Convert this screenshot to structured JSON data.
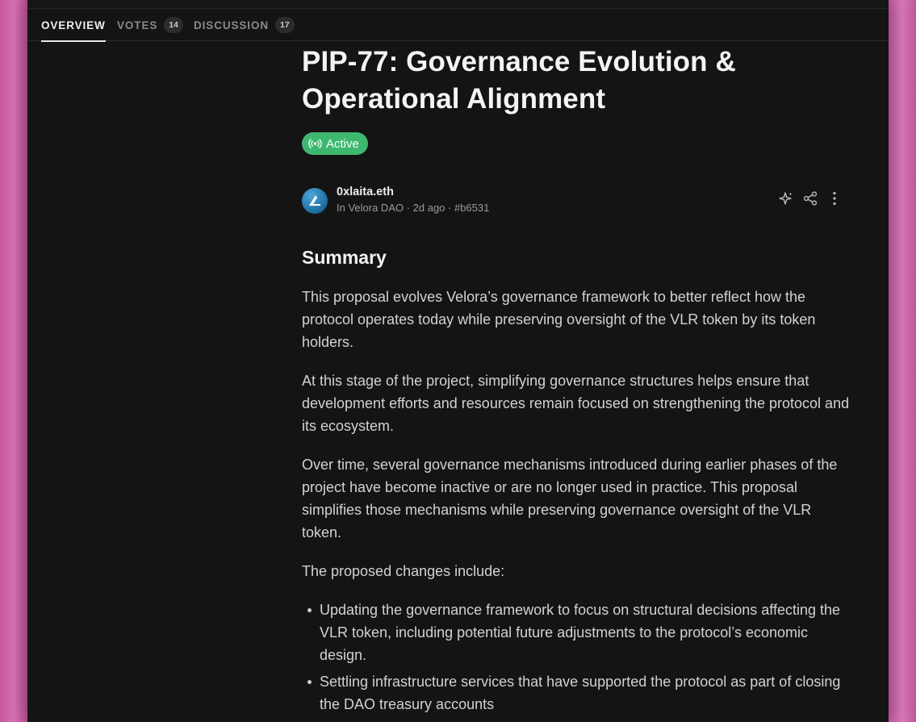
{
  "tabs": [
    {
      "label": "OVERVIEW",
      "active": true
    },
    {
      "label": "VOTES",
      "count": "14"
    },
    {
      "label": "DISCUSSION",
      "count": "17"
    }
  ],
  "proposal": {
    "title_line1": "PIP-77: Governance Evolution &",
    "title_line2": "Operational Alignment",
    "status": "Active",
    "status_color": "#3fb86f",
    "author": "0xlaita.eth",
    "meta": "In Velora DAO · 2d ago · #b6531",
    "actions": [
      "sparkle-icon",
      "share-icon",
      "more-vertical-icon"
    ]
  },
  "body": {
    "summary_heading": "Summary",
    "paragraphs": [
      "This proposal evolves Velora’s governance framework to better reflect how the protocol operates today while preserving oversight of the VLR token by its token holders.",
      "At this stage of the project, simplifying governance structures helps ensure that development efforts and resources remain focused on strengthening the protocol and its ecosystem.",
      "Over time, several governance mechanisms introduced during earlier phases of the project have become inactive or are no longer used in practice. This proposal simplifies those mechanisms while preserving governance oversight of the VLR token.",
      "The proposed changes include:"
    ],
    "changes": [
      "Updating the governance framework to focus on structural decisions affecting the VLR token, including potential future adjustments to the protocol’s economic design.",
      "Settling infrastructure services that have supported the protocol as part of closing the DAO treasury accounts"
    ]
  },
  "colors": {
    "background_accent": "#c04f96",
    "panel": "#141414"
  }
}
